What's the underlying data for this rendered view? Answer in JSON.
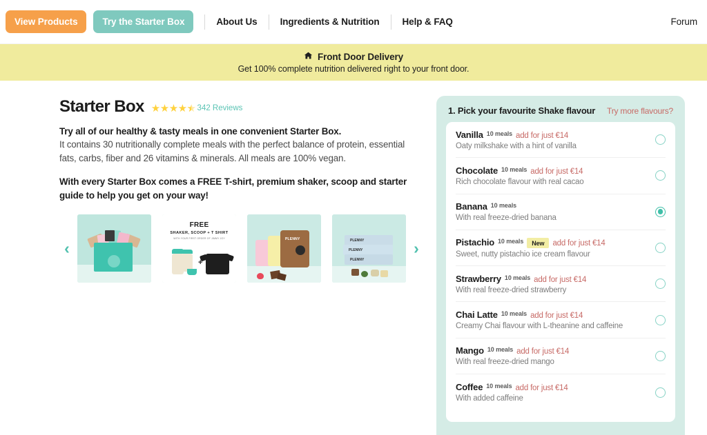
{
  "nav": {
    "primary_button": "View Products",
    "secondary_button": "Try the Starter Box",
    "links": [
      "About Us",
      "Ingredients & Nutrition",
      "Help & FAQ"
    ],
    "forum": "Forum",
    "colors": {
      "orange": "#F6A04A",
      "teal": "#7FC9BE"
    }
  },
  "banner": {
    "icon": "home-icon",
    "title": "Front Door Delivery",
    "subtitle": "Get 100% complete nutrition delivered right to your front door.",
    "background": "#F0EB9D"
  },
  "product": {
    "title": "Starter Box",
    "rating": 4.5,
    "stars_full": 4,
    "stars_half": 1,
    "reviews_label": "342 Reviews",
    "reviews_count": 342,
    "headline": "Try all of our healthy & tasty meals in one convenient Starter Box.",
    "body": "It contains 30 nutritionally complete meals with the perfect balance of protein, essential fats, carbs, fiber and 26 vitamins & minerals. All meals are 100% vegan.",
    "bonus": "With every Starter Box comes a FREE T-shirt, premium shaker, scoop and starter guide to help you get on your way!"
  },
  "carousel": {
    "prev_label": "‹",
    "next_label": "›",
    "thumbnails": [
      {
        "alt": "Starter box opened with products"
      },
      {
        "alt": "Free shaker, scoop and t-shirt",
        "free_label": "FREE",
        "items_label": "SHAKER, SCOOP + T SHIRT",
        "note_label": "WITH YOUR FIRST ORDER OF JIMMY JOY",
        "plus": "+"
      },
      {
        "alt": "Plenny Shake pouches with chocolate",
        "brand": "PLENNY"
      },
      {
        "alt": "Plenny bar packs with ingredients",
        "brand1": "PLENNY",
        "brand2": "PLENNY",
        "brand3": "PLENNY"
      }
    ]
  },
  "flavour_panel": {
    "step_title": "1. Pick your favourite Shake flavour",
    "more_link": "Try more flavours?",
    "panel_color": "#D5ECE6",
    "accent_color": "#3FBFA8",
    "price_color": "#C76A66",
    "flavours": [
      {
        "name": "Vanilla",
        "meals": "10 meals",
        "price": "add for just €14",
        "badge": "",
        "desc": "Oaty milkshake with a hint of vanilla",
        "selected": false
      },
      {
        "name": "Chocolate",
        "meals": "10 meals",
        "price": "add for just €14",
        "badge": "",
        "desc": "Rich chocolate flavour with real cacao",
        "selected": false
      },
      {
        "name": "Banana",
        "meals": "10 meals",
        "price": "",
        "badge": "",
        "desc": "With real freeze-dried banana",
        "selected": true
      },
      {
        "name": "Pistachio",
        "meals": "10 meals",
        "price": "add for just €14",
        "badge": "New",
        "desc": "Sweet, nutty pistachio ice cream flavour",
        "selected": false
      },
      {
        "name": "Strawberry",
        "meals": "10 meals",
        "price": "add for just €14",
        "badge": "",
        "desc": "With real freeze-dried strawberry",
        "selected": false
      },
      {
        "name": "Chai Latte",
        "meals": "10 meals",
        "price": "add for just €14",
        "badge": "",
        "desc": "Creamy Chai flavour with L-theanine and caffeine",
        "selected": false
      },
      {
        "name": "Mango",
        "meals": "10 meals",
        "price": "add for just €14",
        "badge": "",
        "desc": "With real freeze-dried mango",
        "selected": false
      },
      {
        "name": "Coffee",
        "meals": "10 meals",
        "price": "add for just €14",
        "badge": "",
        "desc": "With added caffeine",
        "selected": false
      }
    ]
  }
}
